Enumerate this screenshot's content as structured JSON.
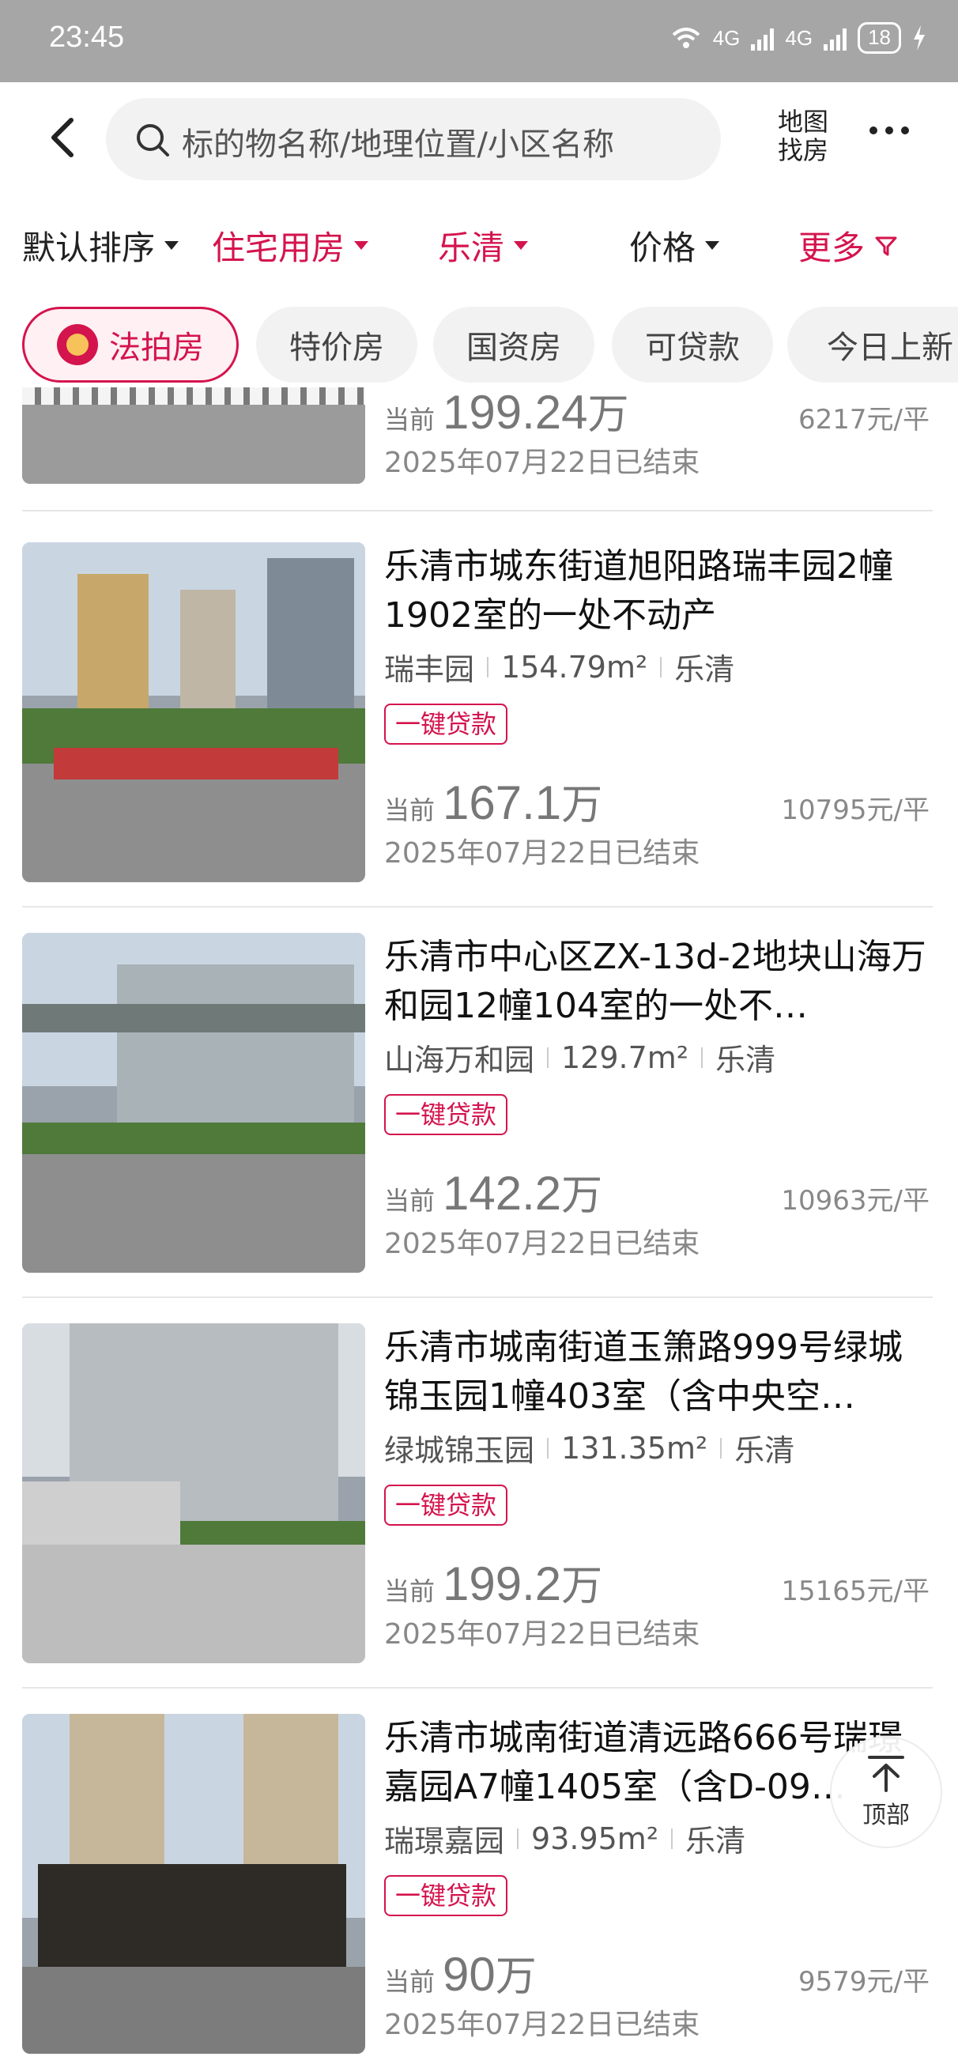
{
  "status_bar": {
    "time": "23:45",
    "network_label": "4G",
    "battery": "18"
  },
  "header": {
    "search_placeholder": "标的物名称/地理位置/小区名称",
    "map_label_line1": "地图",
    "map_label_line2": "找房"
  },
  "filters": [
    {
      "label": "默认排序",
      "active": false
    },
    {
      "label": "住宅用房",
      "active": true
    },
    {
      "label": "乐清",
      "active": true
    },
    {
      "label": "价格",
      "active": false
    },
    {
      "label": "更多",
      "active": true
    }
  ],
  "chips": [
    {
      "label": "法拍房",
      "active": true
    },
    {
      "label": "特价房",
      "active": false
    },
    {
      "label": "国资房",
      "active": false
    },
    {
      "label": "可贷款",
      "active": false
    },
    {
      "label": "今日上新",
      "active": false
    }
  ],
  "listings": [
    {
      "title": "",
      "community": "",
      "area": "",
      "region": "",
      "tag": "",
      "price_prefix": "当前",
      "price": "199.24",
      "price_unit": "万",
      "unit_price": "6217元/平",
      "status": "2025年07月22日已结束"
    },
    {
      "title": "乐清市城东街道旭阳路瑞丰园2幢1902室的一处不动产",
      "community": "瑞丰园",
      "area": "154.79m²",
      "region": "乐清",
      "tag": "一键贷款",
      "price_prefix": "当前",
      "price": "167.1",
      "price_unit": "万",
      "unit_price": "10795元/平",
      "status": "2025年07月22日已结束"
    },
    {
      "title": "乐清市中心区ZX-13d-2地块山海万和园12幢104室的一处不…",
      "community": "山海万和园",
      "area": "129.7m²",
      "region": "乐清",
      "tag": "一键贷款",
      "price_prefix": "当前",
      "price": "142.2",
      "price_unit": "万",
      "unit_price": "10963元/平",
      "status": "2025年07月22日已结束"
    },
    {
      "title": "乐清市城南街道玉箫路999号绿城锦玉园1幢403室（含中央空…",
      "community": "绿城锦玉园",
      "area": "131.35m²",
      "region": "乐清",
      "tag": "一键贷款",
      "price_prefix": "当前",
      "price": "199.2",
      "price_unit": "万",
      "unit_price": "15165元/平",
      "status": "2025年07月22日已结束"
    },
    {
      "title": "乐清市城南街道清远路666号瑞璟嘉园A7幢1405室（含D-09…",
      "community": "瑞璟嘉园",
      "area": "93.95m²",
      "region": "乐清",
      "tag": "一键贷款",
      "price_prefix": "当前",
      "price": "90",
      "price_unit": "万",
      "unit_price": "9579元/平",
      "status": "2025年07月22日已结束"
    }
  ],
  "top_button_label": "顶部",
  "colors": {
    "accent": "#d4144d",
    "status_bar": "#a6a6a6",
    "chip_bg": "#f2f2f2"
  }
}
